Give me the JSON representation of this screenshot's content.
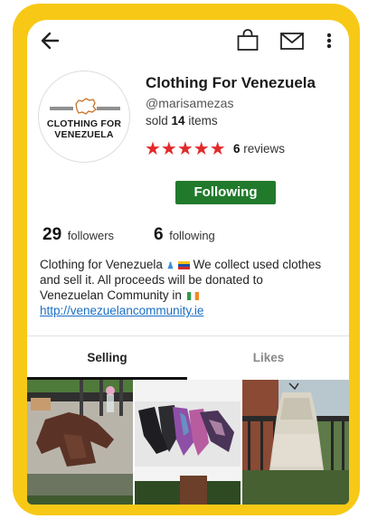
{
  "toolbar": {
    "back_icon": "arrow-left-icon",
    "bag_icon": "shopping-bag-icon",
    "mail_icon": "envelope-icon",
    "more_icon": "more-vertical-icon"
  },
  "profile": {
    "avatar_line1": "CLOTHING FOR",
    "avatar_line2": "VENEZUELA",
    "shop_name": "Clothing For Venezuela",
    "username": "@marisamezas",
    "sold_prefix": "sold",
    "sold_count": "14",
    "sold_suffix": "items",
    "stars": "★★★★★",
    "rating": 5,
    "reviews_count": "6",
    "reviews_label": "reviews",
    "follow_button": "Following",
    "followers_count": "29",
    "followers_label": "followers",
    "following_count": "6",
    "following_label": "following",
    "bio_text_1": "Clothing for Venezuela",
    "bio_text_2": " We collect used clothes and sell it. All proceeds will be donated to Venezuelan Community in ",
    "bio_link": "http://venezuelancommunity.ie"
  },
  "tabs": [
    {
      "label": "Selling",
      "selected": true
    },
    {
      "label": "Likes",
      "selected": false
    }
  ],
  "colors": {
    "frame": "#f7c916",
    "follow_button": "#217a2c",
    "stars": "#e22a2a",
    "link": "#1a6fc4"
  }
}
